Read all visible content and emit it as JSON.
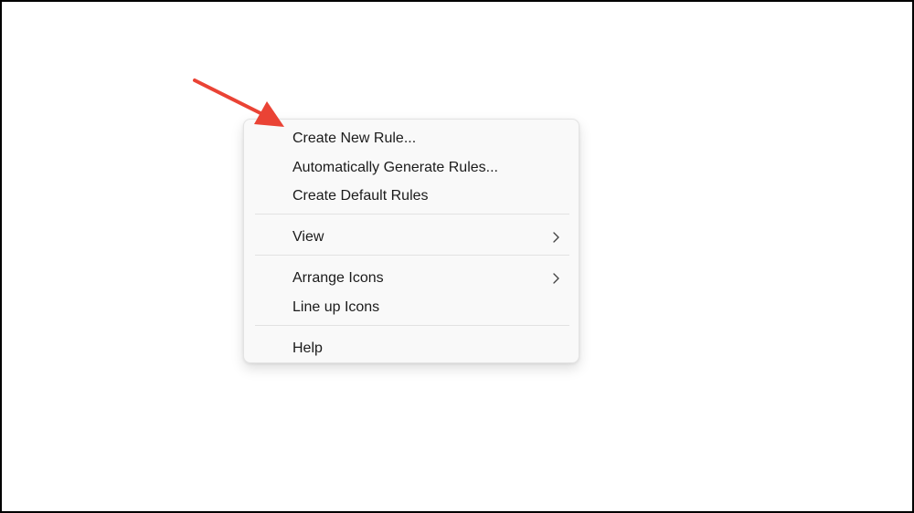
{
  "context_menu": {
    "items": [
      {
        "label": "Create New Rule..."
      },
      {
        "label": "Automatically Generate Rules..."
      },
      {
        "label": "Create Default Rules"
      },
      {
        "label": "View",
        "submenu": true
      },
      {
        "label": "Arrange Icons",
        "submenu": true
      },
      {
        "label": "Line up Icons"
      },
      {
        "label": "Help"
      }
    ]
  },
  "annotation": {
    "arrow_color": "#ea4335"
  },
  "colors": {
    "menu_background": "#f9f9f9",
    "text": "#1b1b1b"
  }
}
